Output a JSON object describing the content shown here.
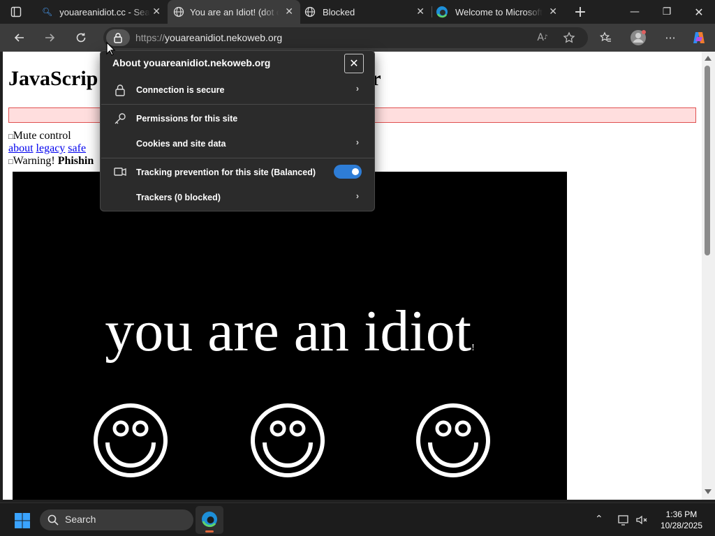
{
  "tabs": [
    {
      "title": "youareanidiot.cc - Search",
      "active": false
    },
    {
      "title": "You are an Idiot! (dot cc)",
      "active": true
    },
    {
      "title": "Blocked",
      "active": false
    },
    {
      "title": "Welcome to Microsoft Edge",
      "active": false
    }
  ],
  "address_bar": {
    "protocol": "https://",
    "host": "youareanidiot.nekoweb.org"
  },
  "page": {
    "heading_left": "JavaScrip",
    "heading_right": "r",
    "mute_alt": "Mute control",
    "links": [
      "about",
      "legacy",
      "safe"
    ],
    "warning_alt": "Warning!",
    "warning_bold": "Phishin",
    "big_text": "you are an idiot",
    "big_text_tail": "!"
  },
  "site_info_popup": {
    "title": "About youareanidiot.nekoweb.org",
    "rows": [
      {
        "label": "Connection is secure",
        "icon": "lock-icon",
        "chevron": true
      },
      {
        "label": "Permissions for this site",
        "icon": "key-icon",
        "chevron": false
      },
      {
        "label": "Cookies and site data",
        "icon": "",
        "chevron": true
      },
      {
        "label": "Tracking prevention for this site (Balanced)",
        "icon": "tracking-icon",
        "toggle": true
      },
      {
        "label": "Trackers (0 blocked)",
        "icon": "",
        "chevron": true
      }
    ],
    "toggle_on": true
  },
  "taskbar": {
    "search_label": "Search",
    "time": "1:36 PM",
    "date": "10/28/2025"
  },
  "colors": {
    "accent": "#2e7dd6",
    "warn_bg": "#ffdede",
    "warn_border": "#e05050"
  }
}
